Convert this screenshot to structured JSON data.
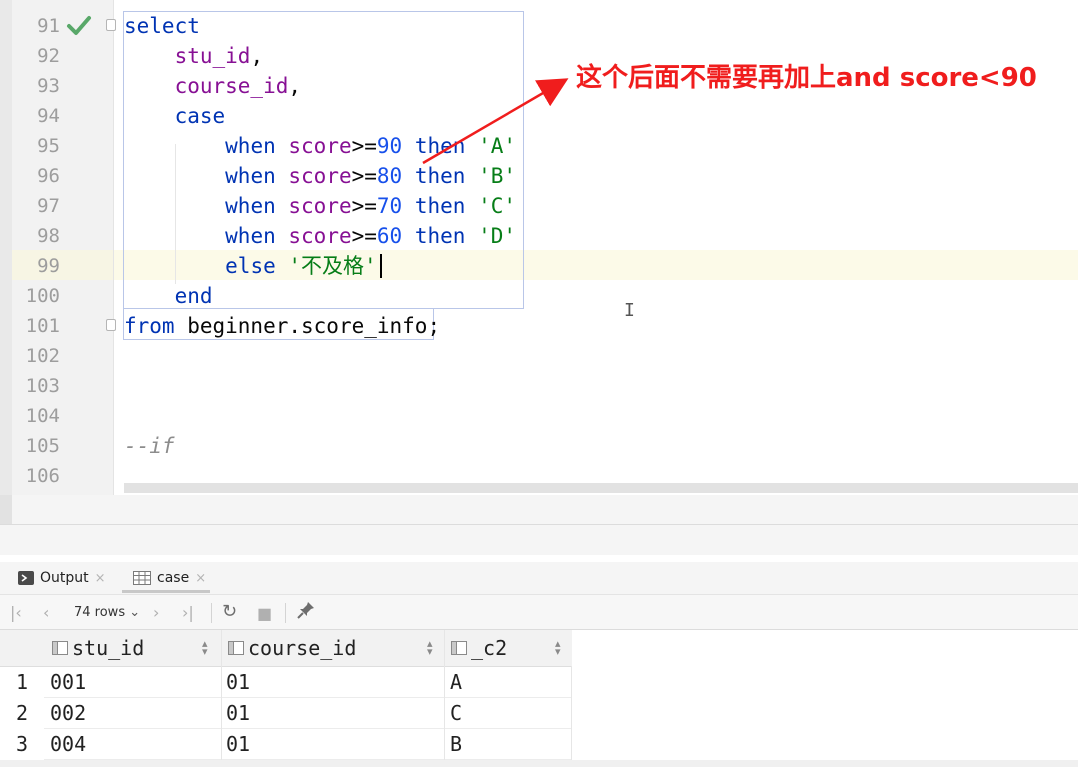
{
  "editor": {
    "lines": [
      {
        "number": "91",
        "segments": [
          {
            "t": "select",
            "c": "kw"
          }
        ]
      },
      {
        "number": "92",
        "segments": [
          {
            "t": "    ",
            "c": "plain"
          },
          {
            "t": "stu_id",
            "c": "fld"
          },
          {
            "t": ",",
            "c": "plain"
          }
        ]
      },
      {
        "number": "93",
        "segments": [
          {
            "t": "    ",
            "c": "plain"
          },
          {
            "t": "course_id",
            "c": "fld"
          },
          {
            "t": ",",
            "c": "plain"
          }
        ]
      },
      {
        "number": "94",
        "segments": [
          {
            "t": "    ",
            "c": "plain"
          },
          {
            "t": "case",
            "c": "kw"
          }
        ]
      },
      {
        "number": "95",
        "segments": [
          {
            "t": "        ",
            "c": "plain"
          },
          {
            "t": "when",
            "c": "kw"
          },
          {
            "t": " ",
            "c": "plain"
          },
          {
            "t": "score",
            "c": "fld"
          },
          {
            "t": ">=",
            "c": "plain"
          },
          {
            "t": "90",
            "c": "num"
          },
          {
            "t": " ",
            "c": "plain"
          },
          {
            "t": "then",
            "c": "kw"
          },
          {
            "t": " ",
            "c": "plain"
          },
          {
            "t": "'A'",
            "c": "str"
          }
        ]
      },
      {
        "number": "96",
        "segments": [
          {
            "t": "        ",
            "c": "plain"
          },
          {
            "t": "when",
            "c": "kw"
          },
          {
            "t": " ",
            "c": "plain"
          },
          {
            "t": "score",
            "c": "fld"
          },
          {
            "t": ">=",
            "c": "plain"
          },
          {
            "t": "80",
            "c": "num"
          },
          {
            "t": " ",
            "c": "plain"
          },
          {
            "t": "then",
            "c": "kw"
          },
          {
            "t": " ",
            "c": "plain"
          },
          {
            "t": "'B'",
            "c": "str"
          }
        ]
      },
      {
        "number": "97",
        "segments": [
          {
            "t": "        ",
            "c": "plain"
          },
          {
            "t": "when",
            "c": "kw"
          },
          {
            "t": " ",
            "c": "plain"
          },
          {
            "t": "score",
            "c": "fld"
          },
          {
            "t": ">=",
            "c": "plain"
          },
          {
            "t": "70",
            "c": "num"
          },
          {
            "t": " ",
            "c": "plain"
          },
          {
            "t": "then",
            "c": "kw"
          },
          {
            "t": " ",
            "c": "plain"
          },
          {
            "t": "'C'",
            "c": "str"
          }
        ]
      },
      {
        "number": "98",
        "segments": [
          {
            "t": "        ",
            "c": "plain"
          },
          {
            "t": "when",
            "c": "kw"
          },
          {
            "t": " ",
            "c": "plain"
          },
          {
            "t": "score",
            "c": "fld"
          },
          {
            "t": ">=",
            "c": "plain"
          },
          {
            "t": "60",
            "c": "num"
          },
          {
            "t": " ",
            "c": "plain"
          },
          {
            "t": "then",
            "c": "kw"
          },
          {
            "t": " ",
            "c": "plain"
          },
          {
            "t": "'D'",
            "c": "str"
          }
        ]
      },
      {
        "number": "99",
        "segments": [
          {
            "t": "        ",
            "c": "plain"
          },
          {
            "t": "else",
            "c": "kw"
          },
          {
            "t": " ",
            "c": "plain"
          },
          {
            "t": "'不及格'",
            "c": "str"
          }
        ]
      },
      {
        "number": "100",
        "segments": [
          {
            "t": "    ",
            "c": "plain"
          },
          {
            "t": "end",
            "c": "kw"
          }
        ]
      },
      {
        "number": "101",
        "segments": [
          {
            "t": "from",
            "c": "kw"
          },
          {
            "t": " beginner.score_info;",
            "c": "plain"
          }
        ]
      },
      {
        "number": "102",
        "segments": []
      },
      {
        "number": "103",
        "segments": []
      },
      {
        "number": "104",
        "segments": []
      },
      {
        "number": "105",
        "segments": [
          {
            "t": "--if",
            "c": "cmt"
          }
        ]
      },
      {
        "number": "106",
        "segments": []
      }
    ]
  },
  "annotation": {
    "text": "这个后面不需要再加上and score<90",
    "color": "#f01d1d"
  },
  "tool_window": {
    "tabs": [
      {
        "label": "Output",
        "icon": "console-icon",
        "close": "×"
      },
      {
        "label": "case",
        "icon": "table-icon",
        "close": "×"
      }
    ]
  },
  "toolbar": {
    "first": "first-page-icon",
    "prev": "previous-page-icon",
    "rows_label": "74 rows",
    "next": "next-page-icon",
    "last": "last-page-icon",
    "refresh": "refresh-icon",
    "stop": "stop-icon",
    "pin": "pin-icon"
  },
  "grid": {
    "columns": [
      "stu_id",
      "course_id",
      "_c2"
    ],
    "rows": [
      {
        "num": "1",
        "cells": [
          "001",
          "01",
          "A"
        ]
      },
      {
        "num": "2",
        "cells": [
          "002",
          "01",
          "C"
        ]
      },
      {
        "num": "3",
        "cells": [
          "004",
          "01",
          "B"
        ]
      }
    ]
  },
  "colors": {
    "keyword": "#0033b3",
    "field": "#871094",
    "number": "#1750eb",
    "string": "#067d17",
    "gutter_check": "#59a869"
  }
}
